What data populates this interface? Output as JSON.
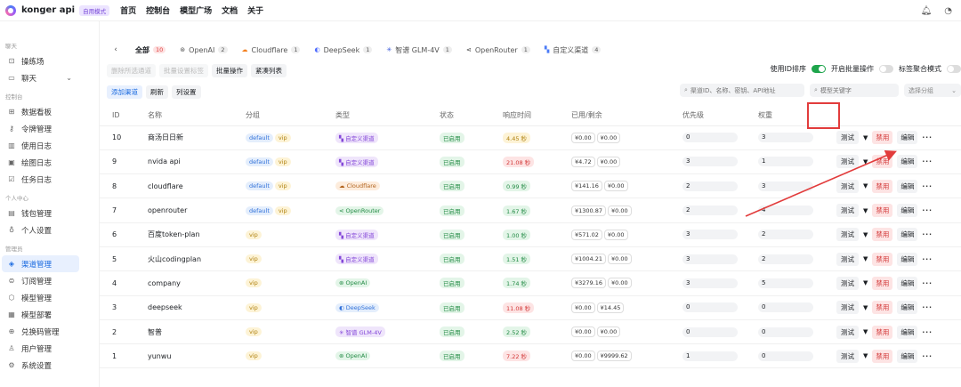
{
  "topbar": {
    "brand": "konger api",
    "mode_tag": "自用模式",
    "nav": [
      "首页",
      "控制台",
      "模型广场",
      "文档",
      "关于"
    ],
    "bell_icon": "bell-icon",
    "avatar_icon": "user-icon"
  },
  "sidebar": {
    "groups": [
      {
        "label": "聊天",
        "items": [
          {
            "label": "操练场",
            "icon": "playground-icon"
          },
          {
            "label": "聊天",
            "icon": "chat-icon",
            "chevron": "⌄"
          }
        ]
      },
      {
        "label": "控制台",
        "items": [
          {
            "label": "数据看板",
            "icon": "dashboard-icon"
          },
          {
            "label": "令牌管理",
            "icon": "key-icon"
          },
          {
            "label": "使用日志",
            "icon": "chart-icon"
          },
          {
            "label": "绘图日志",
            "icon": "image-icon"
          },
          {
            "label": "任务日志",
            "icon": "task-icon"
          }
        ]
      },
      {
        "label": "个人中心",
        "items": [
          {
            "label": "钱包管理",
            "icon": "wallet-icon"
          },
          {
            "label": "个人设置",
            "icon": "person-icon"
          }
        ]
      },
      {
        "label": "管理员",
        "items": [
          {
            "label": "渠道管理",
            "icon": "layers-icon",
            "active": true
          },
          {
            "label": "订阅管理",
            "icon": "subscription-icon"
          },
          {
            "label": "模型管理",
            "icon": "model-icon"
          },
          {
            "label": "模型部署",
            "icon": "deploy-icon"
          },
          {
            "label": "兑换码管理",
            "icon": "redeem-icon"
          },
          {
            "label": "用户管理",
            "icon": "users-icon"
          },
          {
            "label": "系统设置",
            "icon": "settings-icon"
          }
        ]
      }
    ]
  },
  "tabs": [
    {
      "label": "全部",
      "count": "10",
      "active": true,
      "icon": ""
    },
    {
      "label": "OpenAI",
      "count": "2",
      "icon": "⊛",
      "color": "#555"
    },
    {
      "label": "Cloudflare",
      "count": "1",
      "icon": "☁",
      "color": "#f38020"
    },
    {
      "label": "DeepSeek",
      "count": "1",
      "icon": "◐",
      "color": "#4d6bfe"
    },
    {
      "label": "智谱 GLM-4V",
      "count": "1",
      "icon": "✳",
      "color": "#3b5bdb"
    },
    {
      "label": "OpenRouter",
      "count": "1",
      "icon": "⋖",
      "color": "#333"
    },
    {
      "label": "自定义渠道",
      "count": "4",
      "icon": "▚",
      "color": "#4a7bf7"
    }
  ],
  "toolbar": {
    "row1": [
      {
        "label": "删除所选通道",
        "disabled": true
      },
      {
        "label": "批量设置标签",
        "disabled": true
      },
      {
        "label": "批量操作",
        "disabled": false
      },
      {
        "label": "紧凑列表",
        "disabled": false
      }
    ],
    "row2": [
      {
        "label": "添加渠道",
        "primary": true
      },
      {
        "label": "刷新"
      },
      {
        "label": "列设置"
      }
    ],
    "toggle_id_sort": "使用ID排序",
    "toggle_batch": "开启批量操作",
    "toggle_tag_mode": "标签聚合模式",
    "search_channel_placeholder": "渠道ID、名称、密钥、API地址",
    "search_model_placeholder": "模型关键字",
    "group_select": "选择分组"
  },
  "table": {
    "headers": [
      "ID",
      "名称",
      "分组",
      "类型",
      "状态",
      "响应时间",
      "已用/剩余",
      "优先级",
      "权重",
      ""
    ],
    "actions": {
      "test": "测试",
      "ban": "禁用",
      "edit": "编辑",
      "more": "···"
    },
    "rows": [
      {
        "id": "10",
        "name": "商汤日日新",
        "groups": [
          "default",
          "vip"
        ],
        "type": "自定义渠道",
        "type_style": "purple",
        "type_icon": "▚",
        "status": "已启用",
        "resp": "4.45 秒",
        "resp_style": "yellow",
        "used": "¥0.00",
        "remain": "¥0.00",
        "priority": "0",
        "weight": "3"
      },
      {
        "id": "9",
        "name": "nvida api",
        "groups": [
          "default",
          "vip"
        ],
        "type": "自定义渠道",
        "type_style": "purple",
        "type_icon": "▚",
        "status": "已启用",
        "resp": "21.08 秒",
        "resp_style": "red",
        "used": "¥4.72",
        "remain": "¥0.00",
        "priority": "3",
        "weight": "1"
      },
      {
        "id": "8",
        "name": "cloudflare",
        "groups": [
          "default",
          "vip"
        ],
        "type": "Cloudflare",
        "type_style": "orange",
        "type_icon": "☁",
        "status": "已启用",
        "resp": "0.99 秒",
        "resp_style": "green",
        "used": "¥141.16",
        "remain": "¥0.00",
        "priority": "2",
        "weight": "3"
      },
      {
        "id": "7",
        "name": "openrouter",
        "groups": [
          "default",
          "vip"
        ],
        "type": "OpenRouter",
        "type_style": "green",
        "type_icon": "⋖",
        "status": "已启用",
        "resp": "1.67 秒",
        "resp_style": "green",
        "used": "¥1300.87",
        "remain": "¥0.00",
        "priority": "2",
        "weight": "4"
      },
      {
        "id": "6",
        "name": "百度token-plan",
        "groups": [
          "vip"
        ],
        "type": "自定义渠道",
        "type_style": "purple",
        "type_icon": "▚",
        "status": "已启用",
        "resp": "1.00 秒",
        "resp_style": "green",
        "used": "¥571.02",
        "remain": "¥0.00",
        "priority": "3",
        "weight": "2"
      },
      {
        "id": "5",
        "name": "火山codingplan",
        "groups": [
          "vip"
        ],
        "type": "自定义渠道",
        "type_style": "purple",
        "type_icon": "▚",
        "status": "已启用",
        "resp": "1.51 秒",
        "resp_style": "green",
        "used": "¥1004.21",
        "remain": "¥0.00",
        "priority": "3",
        "weight": "2"
      },
      {
        "id": "4",
        "name": "company",
        "groups": [
          "vip"
        ],
        "type": "OpenAI",
        "type_style": "green",
        "type_icon": "⊛",
        "status": "已启用",
        "resp": "1.74 秒",
        "resp_style": "green",
        "used": "¥3279.16",
        "remain": "¥0.00",
        "priority": "3",
        "weight": "5"
      },
      {
        "id": "3",
        "name": "deepseek",
        "groups": [
          "vip"
        ],
        "type": "DeepSeek",
        "type_style": "blue",
        "type_icon": "◐",
        "status": "已启用",
        "resp": "11.08 秒",
        "resp_style": "red",
        "used": "¥0.00",
        "remain": "¥14.45",
        "priority": "0",
        "weight": "0"
      },
      {
        "id": "2",
        "name": "智普",
        "groups": [
          "vip"
        ],
        "type": "智谱 GLM-4V",
        "type_style": "purple",
        "type_icon": "✳",
        "status": "已启用",
        "resp": "2.52 秒",
        "resp_style": "green",
        "used": "¥0.00",
        "remain": "¥0.00",
        "priority": "0",
        "weight": "0"
      },
      {
        "id": "1",
        "name": "yunwu",
        "groups": [
          "vip"
        ],
        "type": "OpenAI",
        "type_style": "green",
        "type_icon": "⊛",
        "status": "已启用",
        "resp": "7.22 秒",
        "resp_style": "red",
        "used": "¥0.00",
        "remain": "¥9999.62",
        "priority": "1",
        "weight": "0"
      }
    ]
  },
  "colors": {
    "accent": "#1d6ce0",
    "annotation": "#e23c3c"
  }
}
